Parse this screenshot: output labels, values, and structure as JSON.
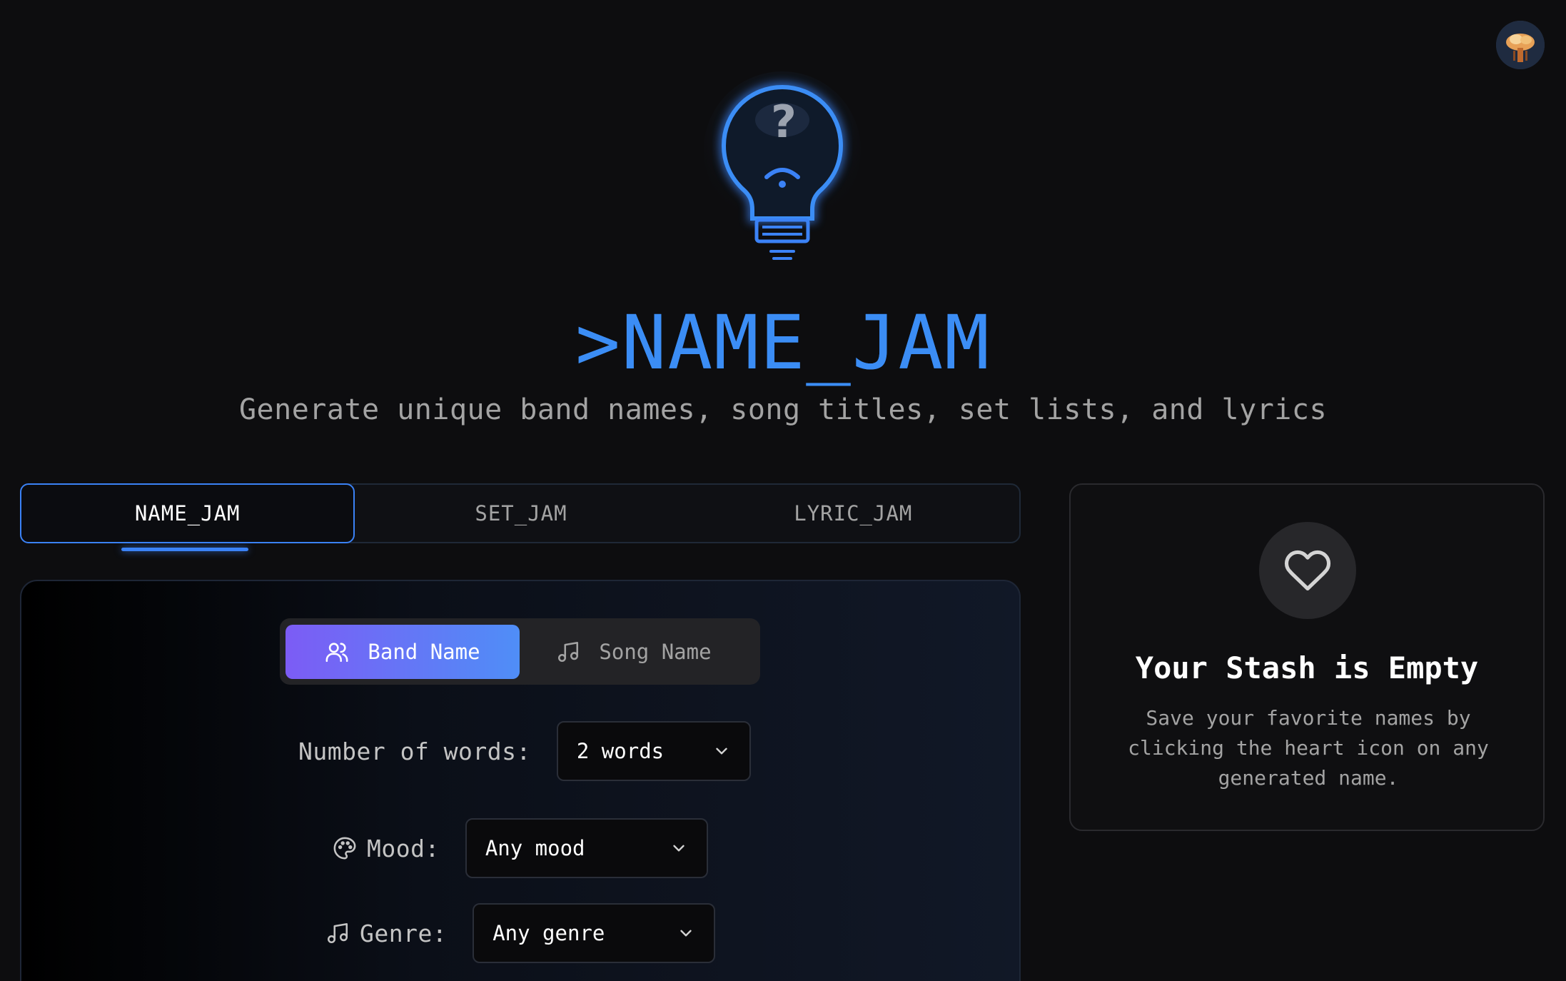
{
  "app": {
    "title": ">NAME_JAM",
    "subtitle": "Generate unique band names, song titles, set lists, and lyrics"
  },
  "icons": {
    "avatar": "user-avatar",
    "hero": "lightbulb-question-icon",
    "band": "users-icon",
    "song": "music-note-icon",
    "mood": "palette-icon",
    "genre": "music-note-icon",
    "chevron": "chevron-down-icon",
    "heart": "heart-icon"
  },
  "colors": {
    "accent": "#3b82f6",
    "toggle_gradient_start": "#7c5cf5",
    "toggle_gradient_end": "#4f8ef7",
    "background": "#0d0d0f"
  },
  "tabs": [
    {
      "label": "NAME_JAM",
      "active": true
    },
    {
      "label": "SET_JAM",
      "active": false
    },
    {
      "label": "LYRIC_JAM",
      "active": false
    }
  ],
  "generator": {
    "mode_toggle": [
      {
        "label": "Band Name",
        "active": true
      },
      {
        "label": "Song Name",
        "active": false
      }
    ],
    "fields": {
      "words": {
        "label": "Number of words:",
        "value": "2 words"
      },
      "mood": {
        "label": "Mood:",
        "value": "Any mood"
      },
      "genre": {
        "label": "Genre:",
        "value": "Any genre"
      }
    }
  },
  "stash": {
    "title": "Your Stash is Empty",
    "description": "Save your favorite names by clicking the heart icon on any generated name."
  }
}
